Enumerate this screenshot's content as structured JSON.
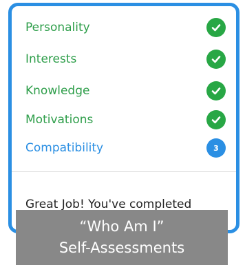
{
  "assessments": {
    "items": [
      {
        "label": "Personality",
        "status": "complete",
        "icon": "check-circle-icon"
      },
      {
        "label": "Interests",
        "status": "complete",
        "icon": "check-circle-icon"
      },
      {
        "label": "Knowledge",
        "status": "complete",
        "icon": "check-circle-icon"
      },
      {
        "label": "Motivations",
        "status": "complete",
        "icon": "check-circle-icon"
      },
      {
        "label": "Compatibility",
        "status": "pending",
        "count": "3"
      }
    ]
  },
  "completion_message": "Great Job! You've completed",
  "caption": {
    "line1": "“Who Am I”",
    "line2": "Self-Assessments"
  },
  "colors": {
    "card_border": "#2b8fe3",
    "complete_text": "#2e9e4a",
    "complete_icon_bg": "#28a745",
    "pending_text": "#2b8fe3",
    "pending_badge_bg": "#2b8fe3",
    "caption_bg": "#888888"
  }
}
